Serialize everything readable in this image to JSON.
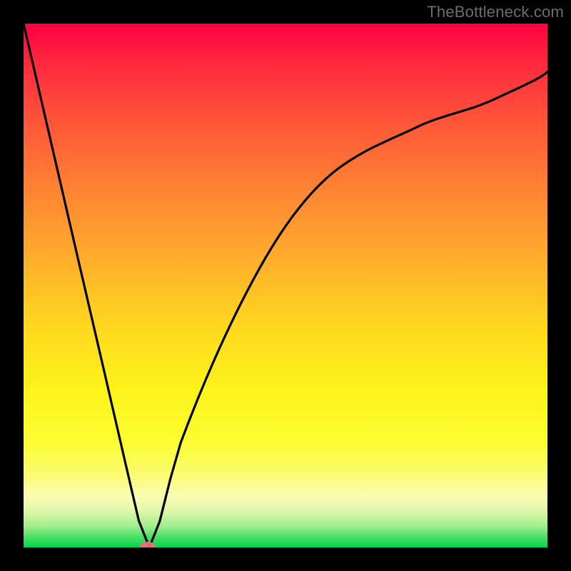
{
  "watermark": "TheBottleneck.com",
  "chart_data": {
    "type": "line",
    "title": "",
    "xlabel": "",
    "ylabel": "",
    "xlim": [
      0,
      100
    ],
    "ylim": [
      0,
      100
    ],
    "x": [
      0,
      5,
      10,
      15,
      20,
      22,
      24,
      26,
      28,
      30,
      35,
      40,
      45,
      50,
      55,
      60,
      65,
      70,
      75,
      80,
      85,
      90,
      95,
      100
    ],
    "values": [
      100,
      78.4,
      56.8,
      35.3,
      13.7,
      5.1,
      0,
      5.0,
      13.0,
      20.0,
      33.4,
      44.2,
      53.2,
      60.7,
      67.0,
      72.3,
      76.6,
      80.2,
      83.2,
      85.6,
      87.5,
      89.0,
      90.1,
      91.0
    ],
    "notch_x": 24,
    "gradient_top_color": "#ff0041",
    "gradient_bottom_color": "#00d64f",
    "curve_color": "#000000",
    "marker_x": 24,
    "marker_y": 0,
    "marker_color": "#e9737c"
  }
}
